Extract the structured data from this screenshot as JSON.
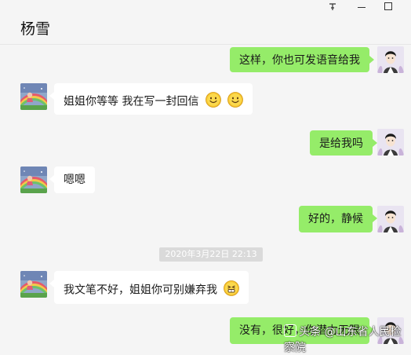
{
  "window": {
    "contact_name": "杨雪",
    "controls": {
      "pin_icon": "pin-icon",
      "minimize_icon": "minimize-icon",
      "maximize_icon": "maximize-icon"
    }
  },
  "messages": [
    {
      "sender": "self",
      "text": "这样，你也可发语音给我"
    },
    {
      "sender": "contact",
      "text": "姐姐你等等 我在写一封回信",
      "emoji": [
        "smile-emoji",
        "smile-emoji"
      ]
    },
    {
      "sender": "self",
      "text": "是给我吗"
    },
    {
      "sender": "contact",
      "text": "嗯嗯"
    },
    {
      "sender": "self",
      "text": "好的，静候"
    },
    {
      "sender": "contact",
      "text": "我文笔不好，姐姐你可别嫌弃我",
      "emoji": [
        "grimace-emoji"
      ]
    },
    {
      "sender": "self",
      "text": "没有，很好，你潜力无限"
    }
  ],
  "timestamp": "2020年3月22日 22:13",
  "watermark": "头条 @山东省人民检察院",
  "colors": {
    "outgoing_bubble": "#95ec69",
    "incoming_bubble": "#ffffff",
    "background": "#f5f5f5"
  }
}
